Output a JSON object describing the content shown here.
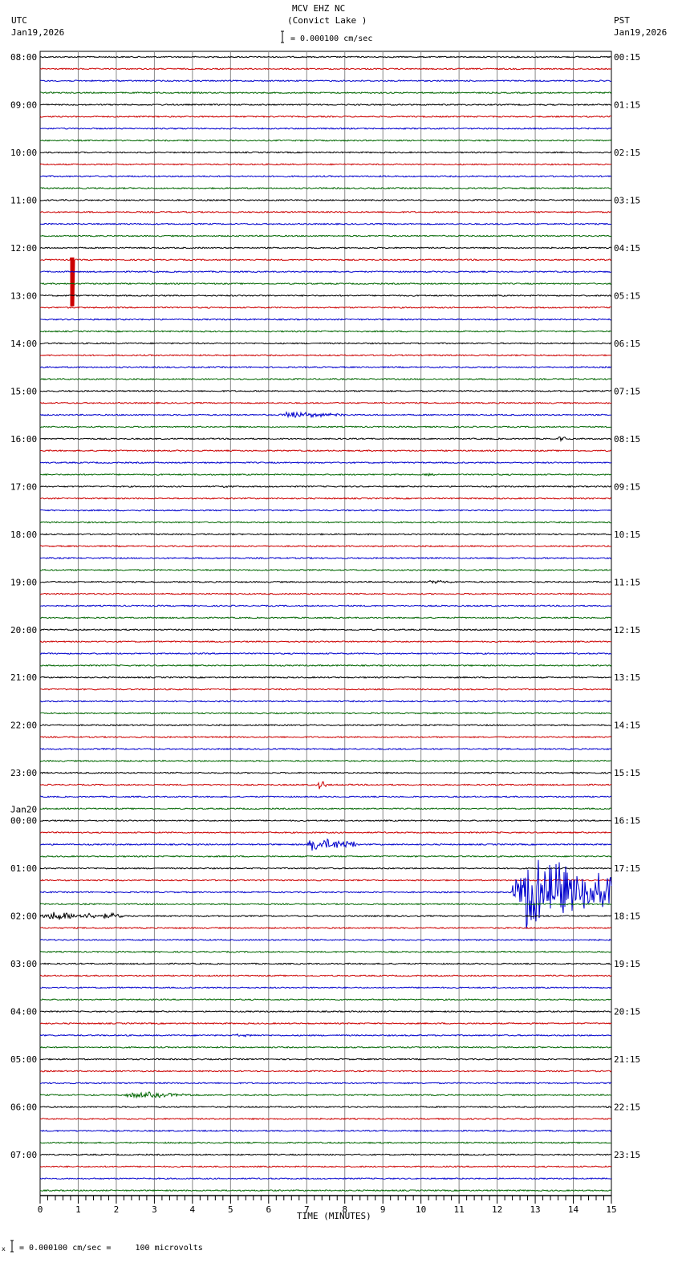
{
  "header": {
    "station": "MCV EHZ NC",
    "location": "(Convict Lake )",
    "left_tz": "UTC",
    "left_date": "Jan19,2026",
    "right_tz": "PST",
    "right_date": "Jan19,2026",
    "scale": "= 0.000100 cm/sec"
  },
  "footer": {
    "scale_note": "= 0.000100 cm/sec =     100 microvolts",
    "mark": "x"
  },
  "chart_data": {
    "type": "line",
    "title": "MCV EHZ NC (Convict Lake )",
    "xlabel": "TIME (MINUTES)",
    "xlim": [
      0,
      15
    ],
    "x_ticks": [
      "0",
      "1",
      "2",
      "3",
      "4",
      "5",
      "6",
      "7",
      "8",
      "9",
      "10",
      "11",
      "12",
      "13",
      "14",
      "15"
    ],
    "trace_count": 96,
    "minutes_per_trace": 15,
    "trace_colors": [
      "#000000",
      "#cc0000",
      "#0000cc",
      "#006600"
    ],
    "left_labels": [
      {
        "trace": 0,
        "text": "08:00"
      },
      {
        "trace": 4,
        "text": "09:00"
      },
      {
        "trace": 8,
        "text": "10:00"
      },
      {
        "trace": 12,
        "text": "11:00"
      },
      {
        "trace": 16,
        "text": "12:00"
      },
      {
        "trace": 20,
        "text": "13:00"
      },
      {
        "trace": 24,
        "text": "14:00"
      },
      {
        "trace": 28,
        "text": "15:00"
      },
      {
        "trace": 32,
        "text": "16:00"
      },
      {
        "trace": 36,
        "text": "17:00"
      },
      {
        "trace": 40,
        "text": "18:00"
      },
      {
        "trace": 44,
        "text": "19:00"
      },
      {
        "trace": 48,
        "text": "20:00"
      },
      {
        "trace": 52,
        "text": "21:00"
      },
      {
        "trace": 56,
        "text": "22:00"
      },
      {
        "trace": 60,
        "text": "23:00"
      },
      {
        "trace": 64,
        "text": "00:00",
        "date": "Jan20"
      },
      {
        "trace": 68,
        "text": "01:00"
      },
      {
        "trace": 72,
        "text": "02:00"
      },
      {
        "trace": 76,
        "text": "03:00"
      },
      {
        "trace": 80,
        "text": "04:00"
      },
      {
        "trace": 84,
        "text": "05:00"
      },
      {
        "trace": 88,
        "text": "06:00"
      },
      {
        "trace": 92,
        "text": "07:00"
      }
    ],
    "right_labels": [
      "00:15",
      "01:15",
      "02:15",
      "03:15",
      "04:15",
      "05:15",
      "06:15",
      "07:15",
      "08:15",
      "09:15",
      "10:15",
      "11:15",
      "12:15",
      "13:15",
      "14:15",
      "15:15",
      "16:15",
      "17:15",
      "18:15",
      "19:15",
      "20:15",
      "21:15",
      "22:15",
      "23:15"
    ],
    "events": [
      {
        "trace": 17,
        "start": 0.8,
        "end": 0.9,
        "amp": 58,
        "type": "spike"
      },
      {
        "trace": 30,
        "start": 6.3,
        "end": 8.0,
        "amp": 4
      },
      {
        "trace": 32,
        "start": 13.6,
        "end": 13.8,
        "amp": 4
      },
      {
        "trace": 35,
        "start": 10.1,
        "end": 10.5,
        "amp": 2
      },
      {
        "trace": 36,
        "start": 4.8,
        "end": 5.1,
        "amp": 2
      },
      {
        "trace": 44,
        "start": 10.2,
        "end": 10.8,
        "amp": 3
      },
      {
        "trace": 61,
        "start": 7.3,
        "end": 7.5,
        "amp": 9
      },
      {
        "trace": 66,
        "start": 7.0,
        "end": 8.3,
        "amp": 9
      },
      {
        "trace": 70,
        "start": 12.4,
        "end": 15.0,
        "amp": 45
      },
      {
        "trace": 72,
        "start": 0.0,
        "end": 2.2,
        "amp": 6
      },
      {
        "trace": 73,
        "start": 3.5,
        "end": 3.6,
        "amp": 3
      },
      {
        "trace": 82,
        "start": 5.1,
        "end": 5.8,
        "amp": 2
      },
      {
        "trace": 87,
        "start": 2.2,
        "end": 4.0,
        "amp": 4
      }
    ]
  }
}
